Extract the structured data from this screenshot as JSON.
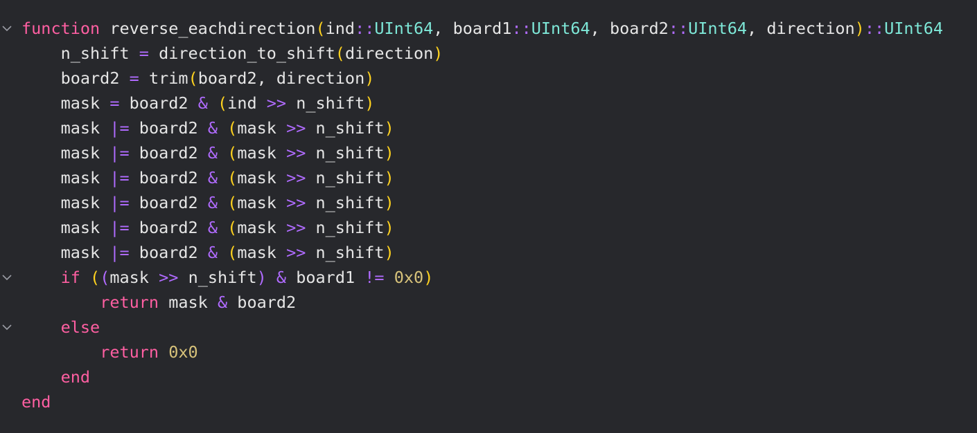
{
  "colors": {
    "background": "#27282c",
    "keyword": "#ff5fa2",
    "identifier": "#e6e6e6",
    "operator": "#b06bff",
    "type": "#7ee8d8",
    "paren": "#ffd21f",
    "number": "#d7c27a"
  },
  "code": {
    "lines": [
      {
        "indent": "",
        "fold": true,
        "tokens": [
          {
            "t": "function",
            "c": "kw"
          },
          {
            "t": " ",
            "c": "pun"
          },
          {
            "t": "reverse_eachdirection",
            "c": "fn"
          },
          {
            "t": "(",
            "c": "paren"
          },
          {
            "t": "ind",
            "c": "id"
          },
          {
            "t": "::",
            "c": "op"
          },
          {
            "t": "UInt64",
            "c": "type"
          },
          {
            "t": ", ",
            "c": "pun"
          },
          {
            "t": "board1",
            "c": "id"
          },
          {
            "t": "::",
            "c": "op"
          },
          {
            "t": "UInt64",
            "c": "type"
          },
          {
            "t": ", ",
            "c": "pun"
          },
          {
            "t": "board2",
            "c": "id"
          },
          {
            "t": "::",
            "c": "op"
          },
          {
            "t": "UInt64",
            "c": "type"
          },
          {
            "t": ", ",
            "c": "pun"
          },
          {
            "t": "direction",
            "c": "id"
          },
          {
            "t": ")",
            "c": "paren"
          },
          {
            "t": "::",
            "c": "op"
          },
          {
            "t": "UInt64",
            "c": "type"
          }
        ]
      },
      {
        "indent": "    ",
        "fold": false,
        "tokens": [
          {
            "t": "n_shift",
            "c": "id"
          },
          {
            "t": " ",
            "c": "pun"
          },
          {
            "t": "=",
            "c": "op"
          },
          {
            "t": " ",
            "c": "pun"
          },
          {
            "t": "direction_to_shift",
            "c": "fn"
          },
          {
            "t": "(",
            "c": "paren"
          },
          {
            "t": "direction",
            "c": "id"
          },
          {
            "t": ")",
            "c": "paren"
          }
        ]
      },
      {
        "indent": "    ",
        "fold": false,
        "tokens": [
          {
            "t": "board2",
            "c": "id"
          },
          {
            "t": " ",
            "c": "pun"
          },
          {
            "t": "=",
            "c": "op"
          },
          {
            "t": " ",
            "c": "pun"
          },
          {
            "t": "trim",
            "c": "fn"
          },
          {
            "t": "(",
            "c": "paren"
          },
          {
            "t": "board2",
            "c": "id"
          },
          {
            "t": ", ",
            "c": "pun"
          },
          {
            "t": "direction",
            "c": "id"
          },
          {
            "t": ")",
            "c": "paren"
          }
        ]
      },
      {
        "indent": "    ",
        "fold": false,
        "tokens": [
          {
            "t": "mask",
            "c": "id"
          },
          {
            "t": " ",
            "c": "pun"
          },
          {
            "t": "=",
            "c": "op"
          },
          {
            "t": " ",
            "c": "pun"
          },
          {
            "t": "board2",
            "c": "id"
          },
          {
            "t": " ",
            "c": "pun"
          },
          {
            "t": "&",
            "c": "op"
          },
          {
            "t": " ",
            "c": "pun"
          },
          {
            "t": "(",
            "c": "paren"
          },
          {
            "t": "ind",
            "c": "id"
          },
          {
            "t": " ",
            "c": "pun"
          },
          {
            "t": ">>",
            "c": "op"
          },
          {
            "t": " ",
            "c": "pun"
          },
          {
            "t": "n_shift",
            "c": "id"
          },
          {
            "t": ")",
            "c": "paren"
          }
        ]
      },
      {
        "indent": "    ",
        "fold": false,
        "tokens": [
          {
            "t": "mask",
            "c": "id"
          },
          {
            "t": " ",
            "c": "pun"
          },
          {
            "t": "|=",
            "c": "op"
          },
          {
            "t": " ",
            "c": "pun"
          },
          {
            "t": "board2",
            "c": "id"
          },
          {
            "t": " ",
            "c": "pun"
          },
          {
            "t": "&",
            "c": "op"
          },
          {
            "t": " ",
            "c": "pun"
          },
          {
            "t": "(",
            "c": "paren"
          },
          {
            "t": "mask",
            "c": "id"
          },
          {
            "t": " ",
            "c": "pun"
          },
          {
            "t": ">>",
            "c": "op"
          },
          {
            "t": " ",
            "c": "pun"
          },
          {
            "t": "n_shift",
            "c": "id"
          },
          {
            "t": ")",
            "c": "paren"
          }
        ]
      },
      {
        "indent": "    ",
        "fold": false,
        "tokens": [
          {
            "t": "mask",
            "c": "id"
          },
          {
            "t": " ",
            "c": "pun"
          },
          {
            "t": "|=",
            "c": "op"
          },
          {
            "t": " ",
            "c": "pun"
          },
          {
            "t": "board2",
            "c": "id"
          },
          {
            "t": " ",
            "c": "pun"
          },
          {
            "t": "&",
            "c": "op"
          },
          {
            "t": " ",
            "c": "pun"
          },
          {
            "t": "(",
            "c": "paren"
          },
          {
            "t": "mask",
            "c": "id"
          },
          {
            "t": " ",
            "c": "pun"
          },
          {
            "t": ">>",
            "c": "op"
          },
          {
            "t": " ",
            "c": "pun"
          },
          {
            "t": "n_shift",
            "c": "id"
          },
          {
            "t": ")",
            "c": "paren"
          }
        ]
      },
      {
        "indent": "    ",
        "fold": false,
        "tokens": [
          {
            "t": "mask",
            "c": "id"
          },
          {
            "t": " ",
            "c": "pun"
          },
          {
            "t": "|=",
            "c": "op"
          },
          {
            "t": " ",
            "c": "pun"
          },
          {
            "t": "board2",
            "c": "id"
          },
          {
            "t": " ",
            "c": "pun"
          },
          {
            "t": "&",
            "c": "op"
          },
          {
            "t": " ",
            "c": "pun"
          },
          {
            "t": "(",
            "c": "paren"
          },
          {
            "t": "mask",
            "c": "id"
          },
          {
            "t": " ",
            "c": "pun"
          },
          {
            "t": ">>",
            "c": "op"
          },
          {
            "t": " ",
            "c": "pun"
          },
          {
            "t": "n_shift",
            "c": "id"
          },
          {
            "t": ")",
            "c": "paren"
          }
        ]
      },
      {
        "indent": "    ",
        "fold": false,
        "tokens": [
          {
            "t": "mask",
            "c": "id"
          },
          {
            "t": " ",
            "c": "pun"
          },
          {
            "t": "|=",
            "c": "op"
          },
          {
            "t": " ",
            "c": "pun"
          },
          {
            "t": "board2",
            "c": "id"
          },
          {
            "t": " ",
            "c": "pun"
          },
          {
            "t": "&",
            "c": "op"
          },
          {
            "t": " ",
            "c": "pun"
          },
          {
            "t": "(",
            "c": "paren"
          },
          {
            "t": "mask",
            "c": "id"
          },
          {
            "t": " ",
            "c": "pun"
          },
          {
            "t": ">>",
            "c": "op"
          },
          {
            "t": " ",
            "c": "pun"
          },
          {
            "t": "n_shift",
            "c": "id"
          },
          {
            "t": ")",
            "c": "paren"
          }
        ]
      },
      {
        "indent": "    ",
        "fold": false,
        "tokens": [
          {
            "t": "mask",
            "c": "id"
          },
          {
            "t": " ",
            "c": "pun"
          },
          {
            "t": "|=",
            "c": "op"
          },
          {
            "t": " ",
            "c": "pun"
          },
          {
            "t": "board2",
            "c": "id"
          },
          {
            "t": " ",
            "c": "pun"
          },
          {
            "t": "&",
            "c": "op"
          },
          {
            "t": " ",
            "c": "pun"
          },
          {
            "t": "(",
            "c": "paren"
          },
          {
            "t": "mask",
            "c": "id"
          },
          {
            "t": " ",
            "c": "pun"
          },
          {
            "t": ">>",
            "c": "op"
          },
          {
            "t": " ",
            "c": "pun"
          },
          {
            "t": "n_shift",
            "c": "id"
          },
          {
            "t": ")",
            "c": "paren"
          }
        ]
      },
      {
        "indent": "    ",
        "fold": false,
        "tokens": [
          {
            "t": "mask",
            "c": "id"
          },
          {
            "t": " ",
            "c": "pun"
          },
          {
            "t": "|=",
            "c": "op"
          },
          {
            "t": " ",
            "c": "pun"
          },
          {
            "t": "board2",
            "c": "id"
          },
          {
            "t": " ",
            "c": "pun"
          },
          {
            "t": "&",
            "c": "op"
          },
          {
            "t": " ",
            "c": "pun"
          },
          {
            "t": "(",
            "c": "paren"
          },
          {
            "t": "mask",
            "c": "id"
          },
          {
            "t": " ",
            "c": "pun"
          },
          {
            "t": ">>",
            "c": "op"
          },
          {
            "t": " ",
            "c": "pun"
          },
          {
            "t": "n_shift",
            "c": "id"
          },
          {
            "t": ")",
            "c": "paren"
          }
        ]
      },
      {
        "indent": "    ",
        "fold": true,
        "tokens": [
          {
            "t": "if",
            "c": "kw"
          },
          {
            "t": " ",
            "c": "pun"
          },
          {
            "t": "(",
            "c": "paren"
          },
          {
            "t": "(",
            "c": "op"
          },
          {
            "t": "mask",
            "c": "id"
          },
          {
            "t": " ",
            "c": "pun"
          },
          {
            "t": ">>",
            "c": "op"
          },
          {
            "t": " ",
            "c": "pun"
          },
          {
            "t": "n_shift",
            "c": "id"
          },
          {
            "t": ")",
            "c": "op"
          },
          {
            "t": " ",
            "c": "pun"
          },
          {
            "t": "&",
            "c": "op"
          },
          {
            "t": " ",
            "c": "pun"
          },
          {
            "t": "board1",
            "c": "id"
          },
          {
            "t": " ",
            "c": "pun"
          },
          {
            "t": "!=",
            "c": "op"
          },
          {
            "t": " ",
            "c": "pun"
          },
          {
            "t": "0x0",
            "c": "num"
          },
          {
            "t": ")",
            "c": "paren"
          }
        ]
      },
      {
        "indent": "        ",
        "fold": false,
        "tokens": [
          {
            "t": "return",
            "c": "kw"
          },
          {
            "t": " ",
            "c": "pun"
          },
          {
            "t": "mask",
            "c": "id"
          },
          {
            "t": " ",
            "c": "pun"
          },
          {
            "t": "&",
            "c": "op"
          },
          {
            "t": " ",
            "c": "pun"
          },
          {
            "t": "board2",
            "c": "id"
          }
        ]
      },
      {
        "indent": "    ",
        "fold": true,
        "tokens": [
          {
            "t": "else",
            "c": "kw"
          }
        ]
      },
      {
        "indent": "        ",
        "fold": false,
        "tokens": [
          {
            "t": "return",
            "c": "kw"
          },
          {
            "t": " ",
            "c": "pun"
          },
          {
            "t": "0x0",
            "c": "num"
          }
        ]
      },
      {
        "indent": "    ",
        "fold": false,
        "tokens": [
          {
            "t": "end",
            "c": "kw"
          }
        ]
      },
      {
        "indent": "",
        "fold": false,
        "tokens": [
          {
            "t": "end",
            "c": "kw"
          }
        ]
      }
    ]
  }
}
